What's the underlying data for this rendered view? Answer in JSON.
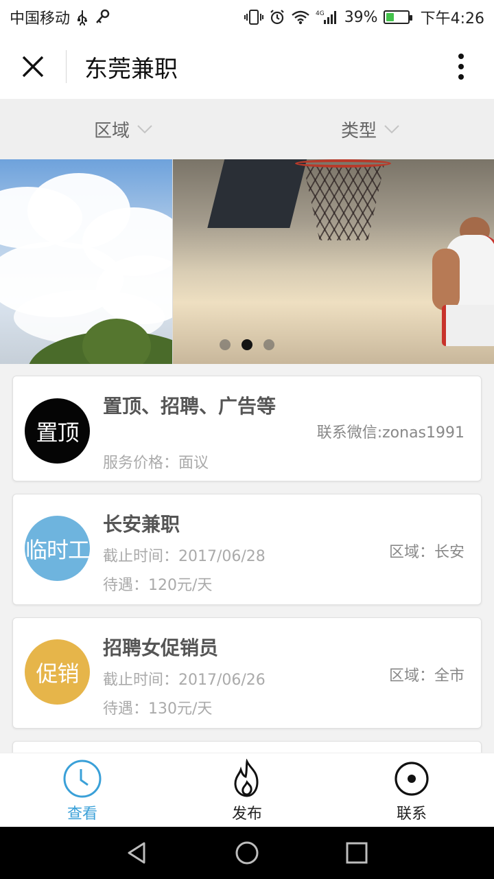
{
  "status_bar": {
    "carrier": "中国移动",
    "network": "4G",
    "battery_percent": "39%",
    "battery_level": 0.39,
    "time": "下午4:26",
    "icons": [
      "usb-icon",
      "key-icon",
      "vibrate-icon",
      "alarm-icon",
      "wifi-icon",
      "signal-icon",
      "battery-icon"
    ]
  },
  "title_bar": {
    "title": "东莞兼职",
    "close_icon": "close-icon",
    "more_icon": "more-vertical-icon"
  },
  "filters": [
    {
      "label": "区域",
      "icon": "chevron-down-icon"
    },
    {
      "label": "类型",
      "icon": "chevron-down-icon"
    }
  ],
  "banner": {
    "slide_count": 3,
    "active_index": 1
  },
  "cards": [
    {
      "avatar_text": "置顶",
      "avatar_color": "#050505",
      "title": "置顶、招聘、广告等",
      "right_text": "联系微信:zonas1991",
      "line1": "",
      "line2": "服务价格：面议"
    },
    {
      "avatar_text": "临时工",
      "avatar_color": "#6eb4de",
      "title": "长安兼职",
      "right_text": "区域：长安",
      "line1": "截止时间：2017/06/28",
      "line2": "待遇：120元/天"
    },
    {
      "avatar_text": "促销",
      "avatar_color": "#e6b54a",
      "title": "招聘女促销员",
      "right_text": "区域：全市",
      "line1": "截止时间：2017/06/26",
      "line2": "待遇：130元/天"
    }
  ],
  "bottom_nav": [
    {
      "label": "查看",
      "icon": "clock-icon",
      "active": true
    },
    {
      "label": "发布",
      "icon": "flame-icon",
      "active": false
    },
    {
      "label": "联系",
      "icon": "target-icon",
      "active": false
    }
  ],
  "colors": {
    "accent": "#3aa0d8",
    "background": "#f2f2f2"
  },
  "system_nav": [
    "back-icon",
    "home-icon",
    "recents-icon"
  ]
}
